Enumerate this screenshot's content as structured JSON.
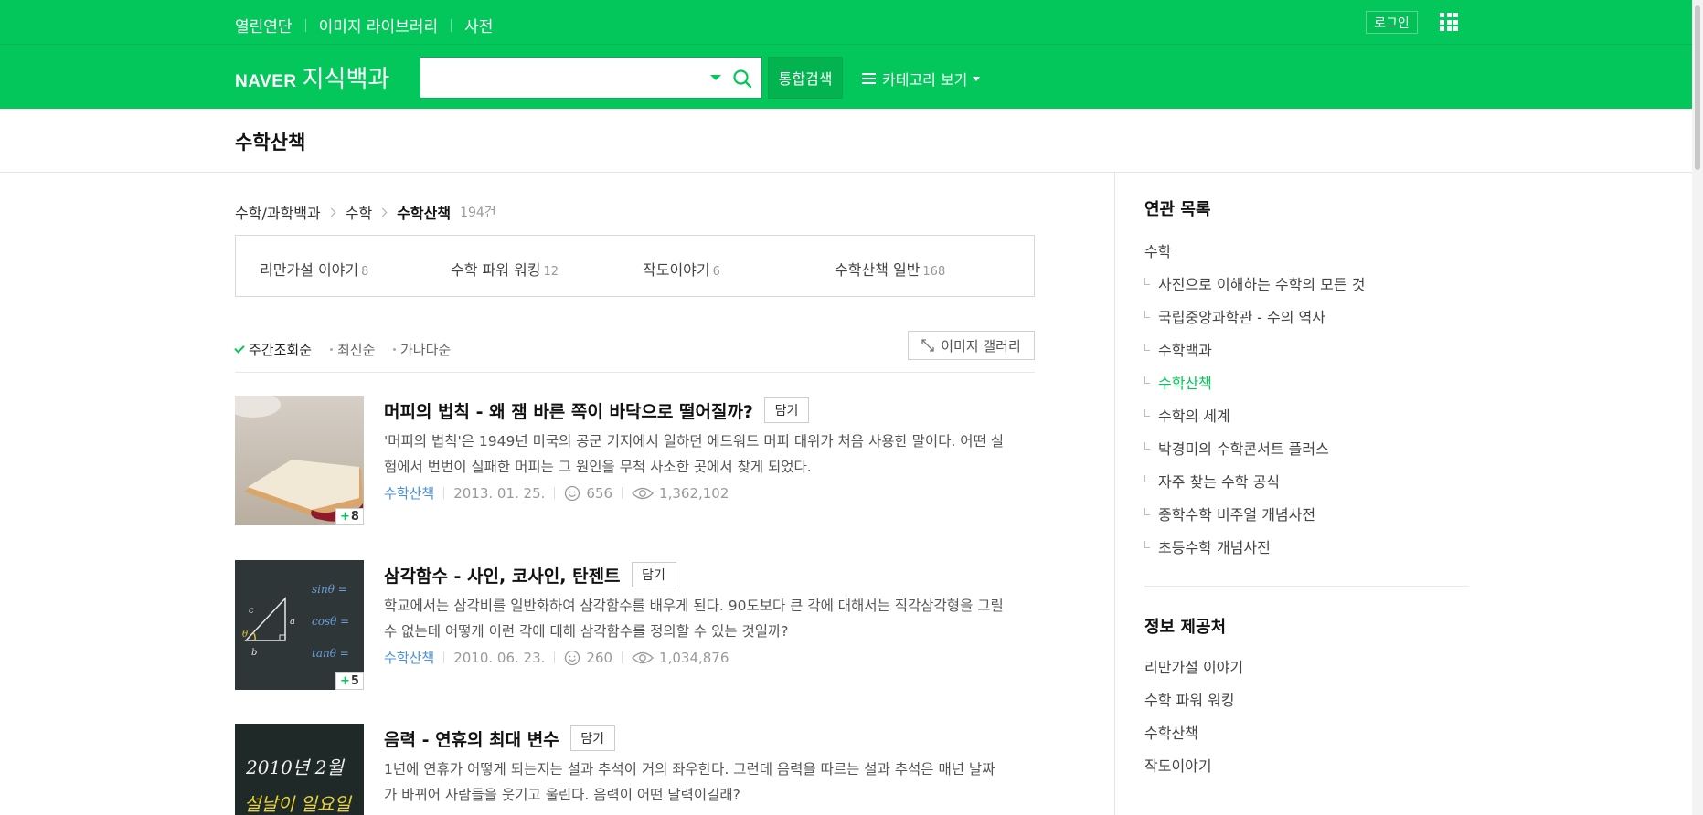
{
  "header": {
    "gnb": [
      "열린연단",
      "이미지 라이브러리",
      "사전"
    ],
    "login": "로그인",
    "logo_naver": "NAVER",
    "logo_service": "지식백과",
    "search_placeholder": "",
    "search_button": "통합검색",
    "category_button": "카테고리 보기",
    "brand_color": "#03c75a"
  },
  "page_title": "수학산책",
  "breadcrumb": {
    "items": [
      "수학/과학백과",
      "수학"
    ],
    "current": "수학산책",
    "count": "194건"
  },
  "subcategories": [
    {
      "label": "리만가설 이야기",
      "count": "8"
    },
    {
      "label": "수학 파워 워킹",
      "count": "12"
    },
    {
      "label": "작도이야기",
      "count": "6"
    },
    {
      "label": "수학산책 일반",
      "count": "168"
    }
  ],
  "sort": {
    "options": [
      "주간조회순",
      "최신순",
      "가나다순"
    ],
    "active": "주간조회순",
    "gallery": "이미지 갤러리"
  },
  "documents": [
    {
      "title": "머피의 법칙 - 왜 잼 바른 쪽이 바닥으로 떨어질까?",
      "save": "담기",
      "desc": "'머피의 법칙'은 1949년 미국의 공군 기지에서 일하던 에드워드 머피 대위가 처음 사용한 말이다. 어떤 실험에서 번번이 실패한 머피는 그 원인을 무척 사소한 곳에서 찾게 되었다.",
      "source": "수학산책",
      "date": "2013. 01. 25.",
      "likes": "656",
      "views": "1,362,102",
      "image_count": "8"
    },
    {
      "title": "삼각함수 - 사인, 코사인, 탄젠트",
      "save": "담기",
      "desc": "학교에서는 삼각비를 일반화하여 삼각함수를 배우게 된다. 90도보다 큰 각에 대해서는 직각삼각형을 그릴 수 없는데 어떻게 이런 각에 대해 삼각함수를 정의할 수 있는 것일까?",
      "source": "수학산책",
      "date": "2010. 06. 23.",
      "likes": "260",
      "views": "1,034,876",
      "image_count": "5"
    },
    {
      "title": "음력 - 연휴의 최대 변수",
      "save": "담기",
      "desc": "1년에 연휴가 어떻게 되는지는 설과 추석이 거의 좌우한다. 그런데 음력을 따르는 설과 추석은 매년 날짜가 바뀌어 사람들을 웃기고 울린다. 음력이 어떤 달력이길래?",
      "thumb_text_1": "2010년 2월",
      "thumb_text_2": "설날이 일요일"
    }
  ],
  "aside": {
    "related_title": "연관 목록",
    "related_root": "수학",
    "related_items": [
      "사진으로 이해하는 수학의 모든 것",
      "국립중앙과학관 - 수의 역사",
      "수학백과",
      "수학산책",
      "수학의 세계",
      "박경미의 수학콘서트 플러스",
      "자주 찾는 수학 공식",
      "중학수학 비주얼 개념사전",
      "초등수학 개념사전"
    ],
    "related_active": "수학산책",
    "provider_title": "정보 제공처",
    "providers": [
      "리만가설 이야기",
      "수학 파워 워킹",
      "수학산책",
      "작도이야기"
    ]
  }
}
